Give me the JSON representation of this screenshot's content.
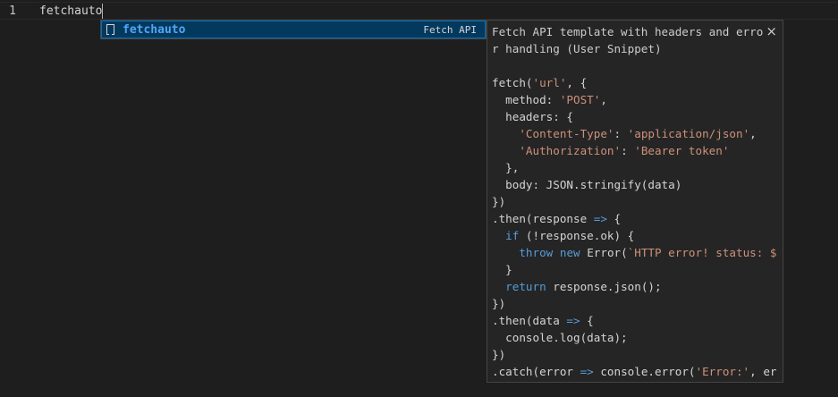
{
  "editor": {
    "line_number": "1",
    "line_text": "fetchauto"
  },
  "suggestion": {
    "icon": "snippet-icon",
    "label": "fetchauto",
    "detail": "Fetch API"
  },
  "details": {
    "header": "Fetch API template with headers and error handling (User Snippet)",
    "close_label": "×",
    "code_lines": [
      [
        {
          "t": "fetch(",
          "c": "plain"
        },
        {
          "t": "'url'",
          "c": "str"
        },
        {
          "t": ", {",
          "c": "plain"
        }
      ],
      [
        {
          "t": "  method: ",
          "c": "plain"
        },
        {
          "t": "'POST'",
          "c": "str"
        },
        {
          "t": ",",
          "c": "plain"
        }
      ],
      [
        {
          "t": "  headers: {",
          "c": "plain"
        }
      ],
      [
        {
          "t": "    ",
          "c": "plain"
        },
        {
          "t": "'Content-Type'",
          "c": "str"
        },
        {
          "t": ": ",
          "c": "plain"
        },
        {
          "t": "'application/json'",
          "c": "str"
        },
        {
          "t": ",",
          "c": "plain"
        }
      ],
      [
        {
          "t": "    ",
          "c": "plain"
        },
        {
          "t": "'Authorization'",
          "c": "str"
        },
        {
          "t": ": ",
          "c": "plain"
        },
        {
          "t": "'Bearer token'",
          "c": "str"
        }
      ],
      [
        {
          "t": "  },",
          "c": "plain"
        }
      ],
      [
        {
          "t": "  body: JSON.stringify(data)",
          "c": "plain"
        }
      ],
      [
        {
          "t": "})",
          "c": "plain"
        }
      ],
      [
        {
          "t": ".then(response ",
          "c": "plain"
        },
        {
          "t": "=>",
          "c": "kw"
        },
        {
          "t": " {",
          "c": "plain"
        }
      ],
      [
        {
          "t": "  ",
          "c": "plain"
        },
        {
          "t": "if",
          "c": "kw"
        },
        {
          "t": " (!response.ok) {",
          "c": "plain"
        }
      ],
      [
        {
          "t": "    ",
          "c": "plain"
        },
        {
          "t": "throw",
          "c": "kw"
        },
        {
          "t": " ",
          "c": "plain"
        },
        {
          "t": "new",
          "c": "kw"
        },
        {
          "t": " Error(",
          "c": "plain"
        },
        {
          "t": "`HTTP error! status: $",
          "c": "str"
        }
      ],
      [
        {
          "t": "  }",
          "c": "plain"
        }
      ],
      [
        {
          "t": "  ",
          "c": "plain"
        },
        {
          "t": "return",
          "c": "kw"
        },
        {
          "t": " response.json();",
          "c": "plain"
        }
      ],
      [
        {
          "t": "})",
          "c": "plain"
        }
      ],
      [
        {
          "t": ".then(data ",
          "c": "plain"
        },
        {
          "t": "=>",
          "c": "kw"
        },
        {
          "t": " {",
          "c": "plain"
        }
      ],
      [
        {
          "t": "  console.log(data);",
          "c": "plain"
        }
      ],
      [
        {
          "t": "})",
          "c": "plain"
        }
      ],
      [
        {
          "t": ".catch(error ",
          "c": "plain"
        },
        {
          "t": "=>",
          "c": "kw"
        },
        {
          "t": " console.error(",
          "c": "plain"
        },
        {
          "t": "'Error:'",
          "c": "str"
        },
        {
          "t": ", er",
          "c": "plain"
        }
      ]
    ]
  }
}
